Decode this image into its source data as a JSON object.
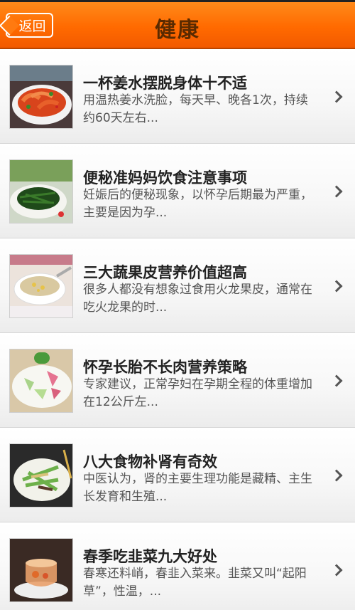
{
  "header": {
    "back_label": "返回",
    "title": "健康",
    "bg_color": "#ff7a10"
  },
  "items": [
    {
      "title": "一杯姜水摆脱身体十不适",
      "desc": "用温热姜水洗脸，每天早、晚各1次，持续约60天左右...",
      "thumb": "shrimp-dish-image"
    },
    {
      "title": "便秘准妈妈饮食注意事项",
      "desc": "妊娠后的便秘现象，以怀孕后期最为严重，主要是因为孕...",
      "thumb": "greens-dish-image"
    },
    {
      "title": "三大蔬果皮营养价值超高",
      "desc": "很多人都没有想象过食用火龙果皮，通常在吃火龙果的时...",
      "thumb": "soup-bowl-image"
    },
    {
      "title": "怀孕长胎不长肉营养策略",
      "desc": "专家建议，正常孕妇在孕期全程的体重增加在12公斤左...",
      "thumb": "melon-salad-image"
    },
    {
      "title": "八大食物补肾有奇效",
      "desc": "中医认为，肾的主要生理功能是藏精、主生长发育和生殖...",
      "thumb": "stir-fry-image"
    },
    {
      "title": "春季吃韭菜九大好处",
      "desc": "春寒还料峭，春韭入菜来。韭菜又叫“起阳草”，性温，...",
      "thumb": "tea-cup-image"
    }
  ]
}
